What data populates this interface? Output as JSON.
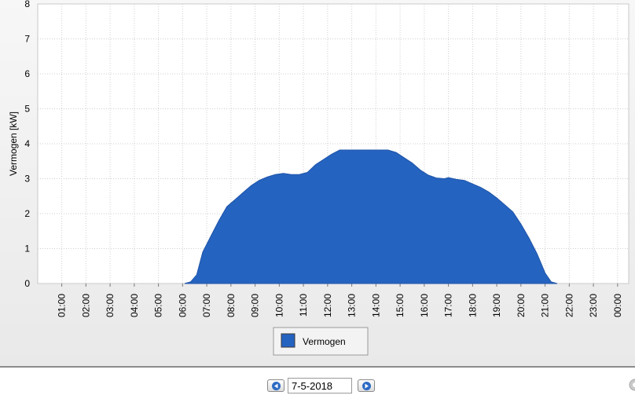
{
  "chart_data": {
    "type": "area",
    "title": "",
    "xlabel": "",
    "ylabel": "Vermogen [kW]",
    "ylim": [
      0,
      8
    ],
    "yticks": [
      0,
      1,
      2,
      3,
      4,
      5,
      6,
      7,
      8
    ],
    "xticks": [
      "01:00",
      "02:00",
      "03:00",
      "04:00",
      "05:00",
      "06:00",
      "07:00",
      "08:00",
      "09:00",
      "10:00",
      "11:00",
      "12:00",
      "13:00",
      "14:00",
      "15:00",
      "16:00",
      "17:00",
      "18:00",
      "19:00",
      "20:00",
      "21:00",
      "22:00",
      "23:00",
      "00:00"
    ],
    "grid": true,
    "legend_position": "bottom",
    "series": [
      {
        "name": "Vermogen",
        "color": "#2563c0",
        "points": [
          [
            "06:05",
            0.0
          ],
          [
            "06:20",
            0.05
          ],
          [
            "06:35",
            0.25
          ],
          [
            "06:50",
            0.9
          ],
          [
            "07:10",
            1.35
          ],
          [
            "07:30",
            1.8
          ],
          [
            "07:50",
            2.2
          ],
          [
            "08:10",
            2.4
          ],
          [
            "08:30",
            2.6
          ],
          [
            "08:50",
            2.8
          ],
          [
            "09:10",
            2.95
          ],
          [
            "09:30",
            3.05
          ],
          [
            "09:50",
            3.12
          ],
          [
            "10:10",
            3.15
          ],
          [
            "10:30",
            3.12
          ],
          [
            "10:50",
            3.12
          ],
          [
            "11:10",
            3.18
          ],
          [
            "11:30",
            3.4
          ],
          [
            "11:50",
            3.55
          ],
          [
            "12:10",
            3.7
          ],
          [
            "12:30",
            3.82
          ],
          [
            "13:00",
            3.82
          ],
          [
            "13:30",
            3.82
          ],
          [
            "14:00",
            3.82
          ],
          [
            "14:30",
            3.82
          ],
          [
            "14:50",
            3.75
          ],
          [
            "15:10",
            3.6
          ],
          [
            "15:30",
            3.45
          ],
          [
            "15:50",
            3.25
          ],
          [
            "16:10",
            3.1
          ],
          [
            "16:30",
            3.02
          ],
          [
            "16:50",
            3.0
          ],
          [
            "17:00",
            3.03
          ],
          [
            "17:20",
            2.98
          ],
          [
            "17:40",
            2.95
          ],
          [
            "18:00",
            2.85
          ],
          [
            "18:20",
            2.75
          ],
          [
            "18:40",
            2.62
          ],
          [
            "19:00",
            2.45
          ],
          [
            "19:20",
            2.25
          ],
          [
            "19:40",
            2.05
          ],
          [
            "20:00",
            1.7
          ],
          [
            "20:20",
            1.3
          ],
          [
            "20:40",
            0.85
          ],
          [
            "21:00",
            0.3
          ],
          [
            "21:15",
            0.05
          ],
          [
            "21:30",
            0.0
          ]
        ]
      }
    ]
  },
  "legend": {
    "label": "Vermogen"
  },
  "navigation": {
    "date_value": "7-5-2018",
    "prev_icon": "arrow-left-icon",
    "next_icon": "arrow-right-icon",
    "settings_icon": "gear-icon"
  }
}
